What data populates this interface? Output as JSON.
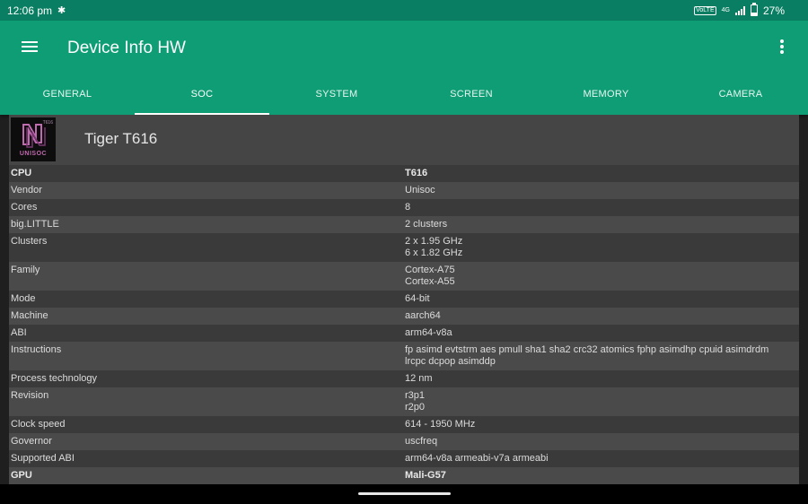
{
  "status_bar": {
    "time": "12:06 pm",
    "battery": "27%",
    "volte_label": "VoLTE",
    "signal_label": "4G"
  },
  "app_bar": {
    "title": "Device Info HW",
    "tabs": [
      {
        "label": "GENERAL",
        "active": false
      },
      {
        "label": "SOC",
        "active": true
      },
      {
        "label": "SYSTEM",
        "active": false
      },
      {
        "label": "SCREEN",
        "active": false
      },
      {
        "label": "MEMORY",
        "active": false
      },
      {
        "label": "CAMERA",
        "active": false
      }
    ]
  },
  "soc_header": {
    "name": "Tiger T616",
    "logo_text": "UNISOC",
    "logo_model": "T616"
  },
  "rows": [
    {
      "key": "CPU",
      "value": "T616",
      "bold": true
    },
    {
      "key": "Vendor",
      "value": "Unisoc"
    },
    {
      "key": "Cores",
      "value": "8"
    },
    {
      "key": "big.LITTLE",
      "value": "2 clusters"
    },
    {
      "key": "Clusters",
      "value": "2 x 1.95 GHz\n6 x 1.82 GHz"
    },
    {
      "key": "Family",
      "value": "Cortex-A75\nCortex-A55"
    },
    {
      "key": "Mode",
      "value": "64-bit"
    },
    {
      "key": "Machine",
      "value": "aarch64"
    },
    {
      "key": "ABI",
      "value": "arm64-v8a"
    },
    {
      "key": "Instructions",
      "value": "fp asimd evtstrm aes pmull sha1 sha2 crc32 atomics fphp asimdhp cpuid asimdrdm\nlrcpc dcpop asimddp"
    },
    {
      "key": "Process technology",
      "value": "12 nm"
    },
    {
      "key": "Revision",
      "value": "r3p1\nr2p0"
    },
    {
      "key": "Clock speed",
      "value": "614 - 1950 MHz"
    },
    {
      "key": "Governor",
      "value": "uscfreq"
    },
    {
      "key": "Supported ABI",
      "value": "arm64-v8a armeabi-v7a armeabi"
    },
    {
      "key": "GPU",
      "value": "Mali-G57",
      "bold": true
    }
  ],
  "colors": {
    "app_bar": "#0f9d75",
    "status_bar": "#0a7e62",
    "row_dark": "#3a3a3a",
    "row_light": "#4a4a4a",
    "logo_accent": "#c06bb0"
  },
  "icons": [
    "menu-icon",
    "more-vert-icon",
    "fan-icon",
    "signal-icon",
    "battery-icon"
  ]
}
